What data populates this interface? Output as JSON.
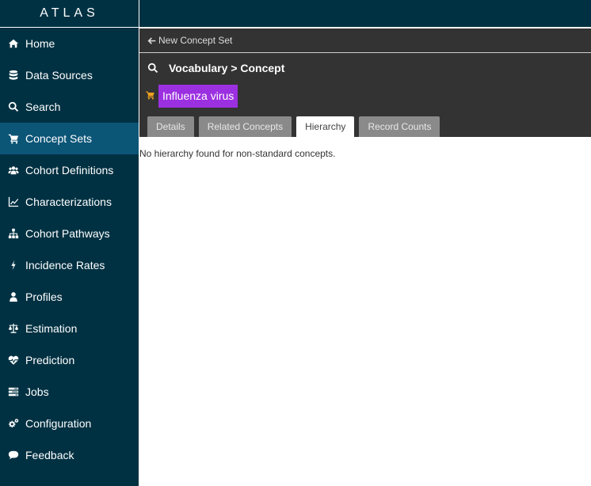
{
  "app": {
    "brand": "ATLAS"
  },
  "sidebar": {
    "items": [
      {
        "label": "Home",
        "icon": "home-icon"
      },
      {
        "label": "Data Sources",
        "icon": "database-icon"
      },
      {
        "label": "Search",
        "icon": "search-icon"
      },
      {
        "label": "Concept Sets",
        "icon": "cart-icon",
        "active": true
      },
      {
        "label": "Cohort Definitions",
        "icon": "users-icon"
      },
      {
        "label": "Characterizations",
        "icon": "line-chart-icon"
      },
      {
        "label": "Cohort Pathways",
        "icon": "sitemap-icon"
      },
      {
        "label": "Incidence Rates",
        "icon": "bolt-icon"
      },
      {
        "label": "Profiles",
        "icon": "user-icon"
      },
      {
        "label": "Estimation",
        "icon": "balance-scale-icon"
      },
      {
        "label": "Prediction",
        "icon": "heartbeat-icon"
      },
      {
        "label": "Jobs",
        "icon": "tasks-icon"
      },
      {
        "label": "Configuration",
        "icon": "cogs-icon"
      },
      {
        "label": "Feedback",
        "icon": "comment-icon"
      }
    ]
  },
  "header": {
    "back_link": "New Concept Set",
    "title": "Vocabulary > Concept",
    "concept_name": "Influenza virus"
  },
  "tabs": [
    {
      "label": "Details"
    },
    {
      "label": "Related Concepts"
    },
    {
      "label": "Hierarchy",
      "active": true
    },
    {
      "label": "Record Counts"
    }
  ],
  "content": {
    "message": "No hierarchy found for non-standard concepts."
  },
  "colors": {
    "sidebar_bg": "#003142",
    "sidebar_active": "#0b5577",
    "panel_bg": "#333333",
    "badge": "#9b30e0",
    "cart": "#f0a020"
  }
}
